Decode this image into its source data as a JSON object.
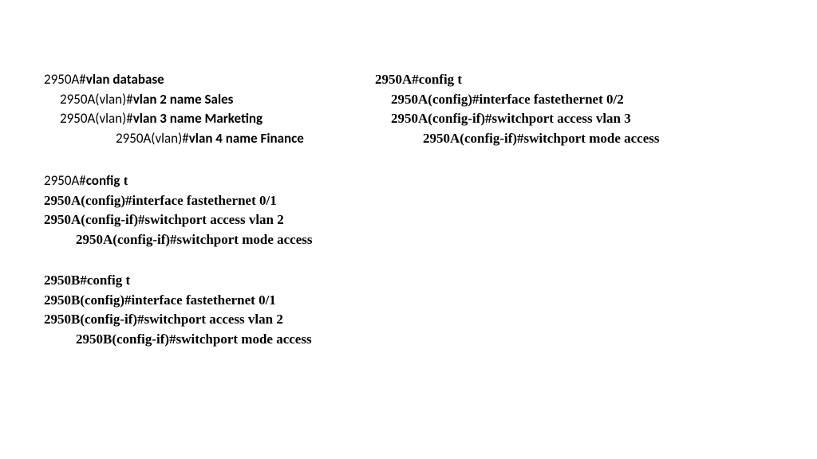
{
  "block1": {
    "l1": {
      "prompt": "2950A#",
      "cmd": "vlan database",
      "indent": 0,
      "style": "sans"
    },
    "l2": {
      "prompt": "2950A(vlan)#",
      "cmd": "vlan 2 name Sales",
      "indent": 20,
      "style": "sans"
    },
    "l3": {
      "prompt": "2950A(vlan)#",
      "cmd": "vlan 3 name Marketing",
      "indent": 20,
      "style": "sans"
    },
    "l4": {
      "prompt": "2950A(vlan)#",
      "cmd": "vlan 4 name Finance",
      "indent": 90,
      "style": "sans"
    }
  },
  "block2": {
    "l1": {
      "prompt": "2950A#",
      "cmd": "config t",
      "indent": 0,
      "style": "comic"
    },
    "l2": {
      "prompt": "2950A(config)#",
      "cmd": "interface fastethernet 0/2",
      "indent": 20,
      "style": "comic"
    },
    "l3": {
      "prompt": "2950A(config-if)#",
      "cmd": "switchport access vlan 3",
      "indent": 20,
      "style": "comic"
    },
    "l4": {
      "prompt": "2950A(config-if)#",
      "cmd": "switchport mode access",
      "indent": 60,
      "style": "comic"
    }
  },
  "block3": {
    "l1a_prompt": "2950A#",
    "l1a_cmd": "config",
    "l1b_cmd": " t",
    "l2": {
      "prompt": "2950A(config)#",
      "cmd": "interface fastethernet 0/1",
      "indent": 0,
      "style": "comic"
    },
    "l3": {
      "prompt": "2950A(config-if)#",
      "cmd": "switchport access vlan 2",
      "indent": 0,
      "style": "comic"
    },
    "l4": {
      "prompt": "2950A(config-if)#",
      "cmd": "switchport mode access",
      "indent": 40,
      "style": "comic"
    }
  },
  "block4": {
    "l1": {
      "prompt": "2950B#",
      "cmd": "config t",
      "indent": 0,
      "style": "comic"
    },
    "l2": {
      "prompt": "2950B(config)#",
      "cmd": "interface fastethernet 0/1",
      "indent": 0,
      "style": "comic"
    },
    "l3": {
      "prompt": "2950B(config-if)#",
      "cmd": "switchport access vlan 2",
      "indent": 0,
      "style": "comic"
    },
    "l4": {
      "prompt": "2950B(config-if)#",
      "cmd": "switchport mode access",
      "indent": 40,
      "style": "comic"
    }
  }
}
